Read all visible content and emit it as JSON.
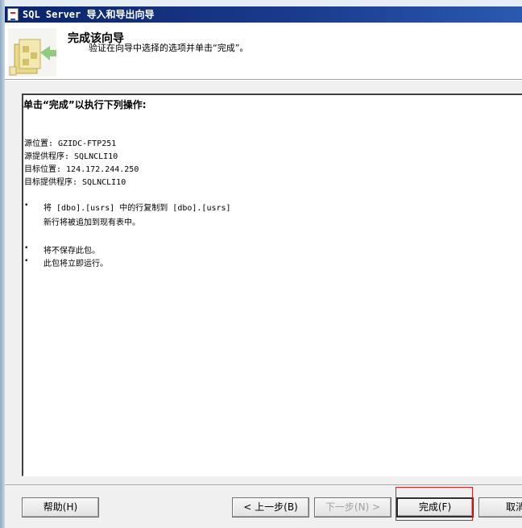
{
  "window": {
    "title": "SQL Server 导入和导出向导"
  },
  "header": {
    "title": "完成该向导",
    "subtitle": "验证在向导中选择的选项并单击“完成”。"
  },
  "summary": {
    "heading": "单击“完成”以执行下列操作:",
    "source_location": "源位置: GZIDC-FTP251",
    "source_provider": "源提供程序: SQLNCLI10",
    "target_location": "目标位置: 124.172.244.250",
    "target_provider": "目标提供程序: SQLNCLI10",
    "bullets": [
      {
        "mark": "•",
        "text": "将 [dbo].[usrs] 中的行复制到 [dbo].[usrs]",
        "detail": "新行将被追加到现有表中。"
      },
      {
        "mark": "•",
        "text": "将不保存此包。"
      },
      {
        "mark": "•",
        "text": "此包将立即运行。"
      }
    ]
  },
  "footer": {
    "help_label": "帮助(H)",
    "back_label": "< 上一步(B)",
    "next_label": "下一步(N) >",
    "finish_label": "完成(F)",
    "cancel_label": "取消"
  },
  "colors": {
    "titlebar": "#0a246a",
    "highlight": "#e02020",
    "disabled_text": "#a0a0a0"
  },
  "icons": {
    "wizard": "wizard-folder-arrow-icon",
    "app": "sql-server-app-icon"
  }
}
